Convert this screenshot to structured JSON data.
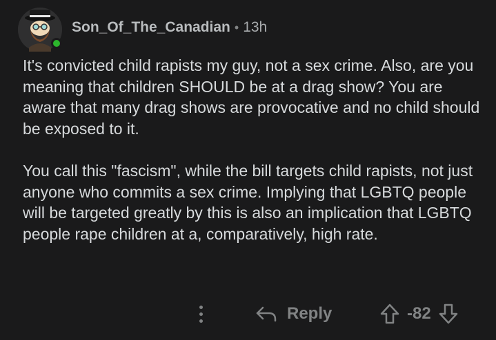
{
  "comment": {
    "username": "Son_Of_The_Canadian",
    "separator": "•",
    "timestamp": "13h",
    "paragraphs": [
      "It's convicted child rapists my guy, not a sex crime. Also, are you meaning that children SHOULD be at a drag show? You are aware that many drag shows are provocative and no child should be exposed to it.",
      "You call this \"fascism\", while the bill targets child rapists, not just anyone who commits a sex crime. Implying that LGBTQ people will be targeted greatly by this is also an implication that LGBTQ people rape children at a, comparatively, high rate."
    ]
  },
  "actions": {
    "more_icon": "more-vertical-icon",
    "reply_icon": "reply-arrow-icon",
    "reply_label": "Reply",
    "upvote_icon": "upvote-arrow-icon",
    "score": "-82",
    "downvote_icon": "downvote-arrow-icon"
  },
  "colors": {
    "background": "#1a1a1b",
    "text": "#d7dadc",
    "muted": "#818384",
    "online": "#2cb62c"
  }
}
